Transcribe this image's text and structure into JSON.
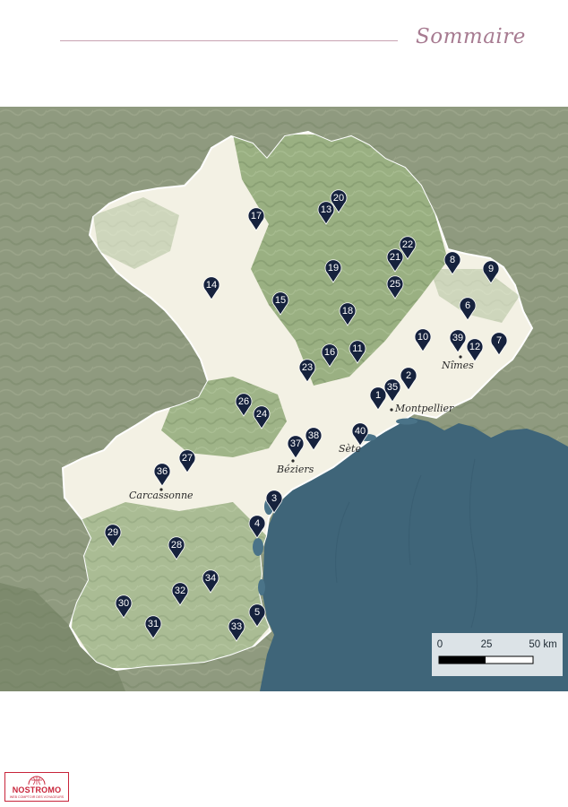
{
  "page": {
    "title": "Sommaire"
  },
  "map": {
    "colors": {
      "sea": "#3f6579",
      "terrain_outside": "#8f9a7f",
      "region_fill": "#f3f1e4",
      "forest": "#8aa571",
      "marker": "#16223d"
    },
    "cities": [
      {
        "name": "Montpellier"
      },
      {
        "name": "Nîmes"
      },
      {
        "name": "Sète"
      },
      {
        "name": "Béziers"
      },
      {
        "name": "Carcassonne"
      }
    ],
    "markers": [
      {
        "label": "1"
      },
      {
        "label": "2"
      },
      {
        "label": "3"
      },
      {
        "label": "4"
      },
      {
        "label": "5"
      },
      {
        "label": "6"
      },
      {
        "label": "7"
      },
      {
        "label": "8"
      },
      {
        "label": "9"
      },
      {
        "label": "10"
      },
      {
        "label": "11"
      },
      {
        "label": "12"
      },
      {
        "label": "13"
      },
      {
        "label": "14"
      },
      {
        "label": "15"
      },
      {
        "label": "16"
      },
      {
        "label": "17"
      },
      {
        "label": "18"
      },
      {
        "label": "19"
      },
      {
        "label": "20"
      },
      {
        "label": "21"
      },
      {
        "label": "22"
      },
      {
        "label": "23"
      },
      {
        "label": "24"
      },
      {
        "label": "25"
      },
      {
        "label": "26"
      },
      {
        "label": "27"
      },
      {
        "label": "28"
      },
      {
        "label": "29"
      },
      {
        "label": "30"
      },
      {
        "label": "31"
      },
      {
        "label": "32"
      },
      {
        "label": "33"
      },
      {
        "label": "34"
      },
      {
        "label": "35"
      },
      {
        "label": "36"
      },
      {
        "label": "37"
      },
      {
        "label": "38"
      },
      {
        "label": "39"
      },
      {
        "label": "40"
      }
    ],
    "scale_bar": {
      "labels": [
        "0",
        "25",
        "50 km"
      ]
    }
  },
  "branding": {
    "name": "NOSTROMO",
    "tagline": "WEB COMPTOIR DES VOYAGEURS"
  }
}
